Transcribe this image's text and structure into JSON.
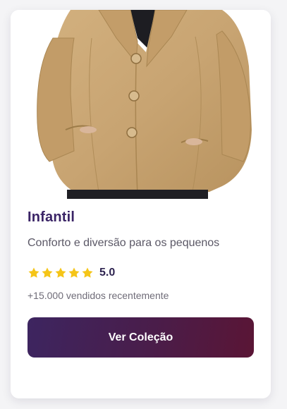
{
  "product": {
    "image_alt": "camel wool coat",
    "category": "Infantil",
    "description": "Conforto e diversão para os pequenos",
    "rating": "5.0",
    "stars_filled": 5,
    "stars_total": 5,
    "sold_text": "+15.000 vendidos recentemente",
    "cta_label": "Ver Coleção"
  },
  "colors": {
    "title": "#3a2466",
    "star": "#f5c518",
    "cta_gradient_start": "#3d2560",
    "cta_gradient_end": "#5a1535",
    "coat": "#c9a574"
  }
}
